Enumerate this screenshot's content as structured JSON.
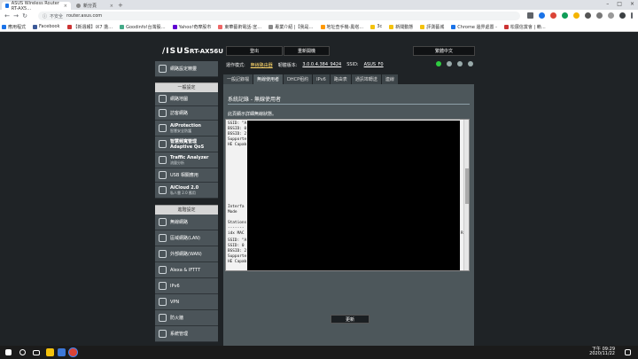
{
  "browser": {
    "tabs": [
      {
        "title": "ASUS Wireless Router RT-AX5…",
        "close": "×"
      },
      {
        "title": "新分頁",
        "close": "×"
      }
    ],
    "new_tab": "+",
    "window_controls": [
      "–",
      "□",
      "×"
    ],
    "nav": {
      "back": "←",
      "forward": "→",
      "reload": "↻"
    },
    "address": {
      "security": "不安全",
      "url": "router.asus.com"
    },
    "bookmarks": [
      "應用程式",
      "Facebook",
      "【新週報】iX7 擔…",
      "Goodinfo!台灣股…",
      "Yahoo!奇摩股市",
      "東華藝術電話-宣…",
      "專業介紹 |【我是…",
      "地址查手機-奧塔…",
      "3c",
      "新聞動態",
      "評測藝城",
      "Chrome 邊界處置 -",
      "松展信賞會 | 賴…"
    ]
  },
  "router": {
    "brand": "/ISUS",
    "model": "RT-AX56U",
    "top_buttons": {
      "logout": "登出",
      "reboot": "重新開機",
      "language": "繁體中文"
    },
    "status": {
      "mode_label": "運作模式:",
      "mode_value": "無線路由器",
      "fw_label": "韌體版本:",
      "fw_value": "3.0.0.4.384_9424",
      "ssid_label": "SSID:",
      "ssid_value": "ASUS_F0"
    },
    "sidebar": {
      "quick": "網路設定精靈",
      "general_head": "一般設定",
      "general": [
        {
          "label": "網路地圖"
        },
        {
          "label": "訪客網路"
        },
        {
          "label": "AiProtection",
          "sub": "智慧安全防護"
        },
        {
          "label": "智慧頻寬管理 Adaptive QoS"
        },
        {
          "label": "Traffic Analyzer",
          "sub": "流量分析"
        },
        {
          "label": "USB 相關應用"
        },
        {
          "label": "AiCloud 2.0",
          "sub": "私人雲 2.0 應用"
        }
      ],
      "advanced_head": "進階設定",
      "advanced": [
        {
          "label": "無線網路"
        },
        {
          "label": "區域網路(LAN)"
        },
        {
          "label": "外部網路(WAN)"
        },
        {
          "label": "Alexa & IFTTT"
        },
        {
          "label": "IPv6"
        },
        {
          "label": "VPN"
        },
        {
          "label": "防火牆"
        },
        {
          "label": "系統管理"
        }
      ]
    },
    "tabs": [
      "一般記錄檔",
      "無線使用者",
      "DHCP租約",
      "IPv6",
      "路由表",
      "通訊埠轉送",
      "連線"
    ],
    "panel": {
      "title": "系統記錄 - 無線使用者",
      "desc": "此頁顯示詳細無線狀態。",
      "log_lines": [
        "SSID: \"A",
        "BSSID: 0",
        "BSSID: 2",
        "Supporte",
        "HE Capab",
        "Interfa",
        "Mode",
        "Stations",
        "-------",
        "idx MAC",
        "SSID: \"A",
        "SSID: 0",
        "BSSID: 2",
        "Supporte",
        "HE Capab"
      ],
      "log_tail": "Re",
      "refresh": "更新"
    }
  },
  "taskbar": {
    "time": "下午 09:29",
    "date": "2020/11/22"
  }
}
